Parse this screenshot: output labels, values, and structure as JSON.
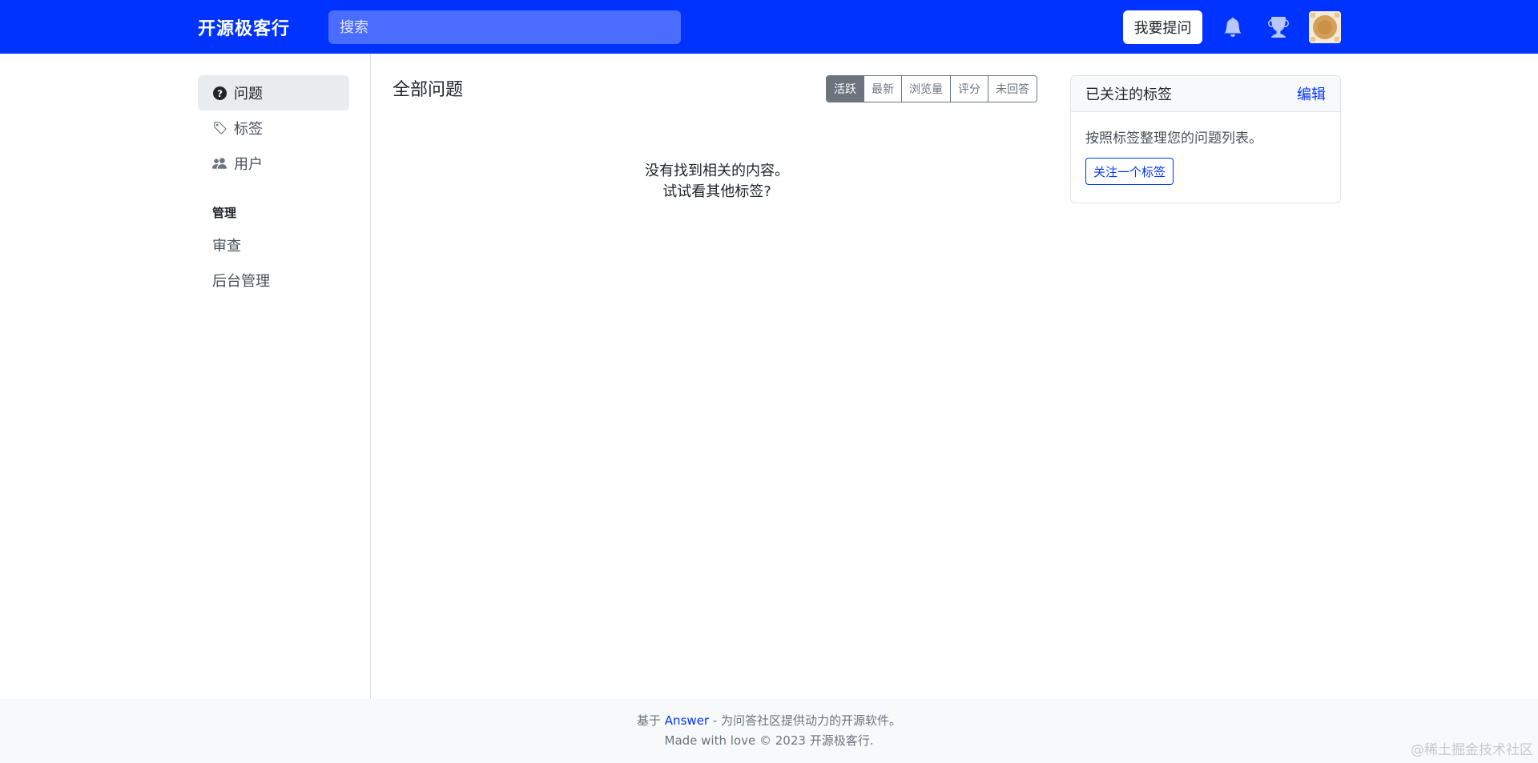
{
  "header": {
    "brand": "开源极客行",
    "search_placeholder": "搜索",
    "ask_label": "我要提问",
    "icons": [
      "bell-icon",
      "trophy-icon"
    ],
    "brand_color": "#0033ff"
  },
  "sidebar": {
    "items": [
      {
        "label": "问题",
        "icon": "question-circle-icon",
        "active": true
      },
      {
        "label": "标签",
        "icon": "tags-icon",
        "active": false
      },
      {
        "label": "用户",
        "icon": "people-icon",
        "active": false
      }
    ],
    "admin_heading": "管理",
    "admin_items": [
      {
        "label": "审查"
      },
      {
        "label": "后台管理"
      }
    ]
  },
  "main": {
    "title": "全部问题",
    "sort_tabs": [
      "活跃",
      "最新",
      "浏览量",
      "评分",
      "未回答"
    ],
    "active_sort": "活跃",
    "empty_line1": "没有找到相关的内容。",
    "empty_line2": "试试看其他标签?"
  },
  "followed_tags": {
    "title": "已关注的标签",
    "edit_label": "编辑",
    "description": "按照标签整理您的问题列表。",
    "follow_button": "关注一个标签"
  },
  "footer": {
    "prefix": "基于",
    "link": "Answer",
    "suffix": " - 为问答社区提供动力的开源软件。",
    "line2": "Made with love © 2023 开源极客行."
  },
  "watermark": "@稀土掘金技术社区"
}
